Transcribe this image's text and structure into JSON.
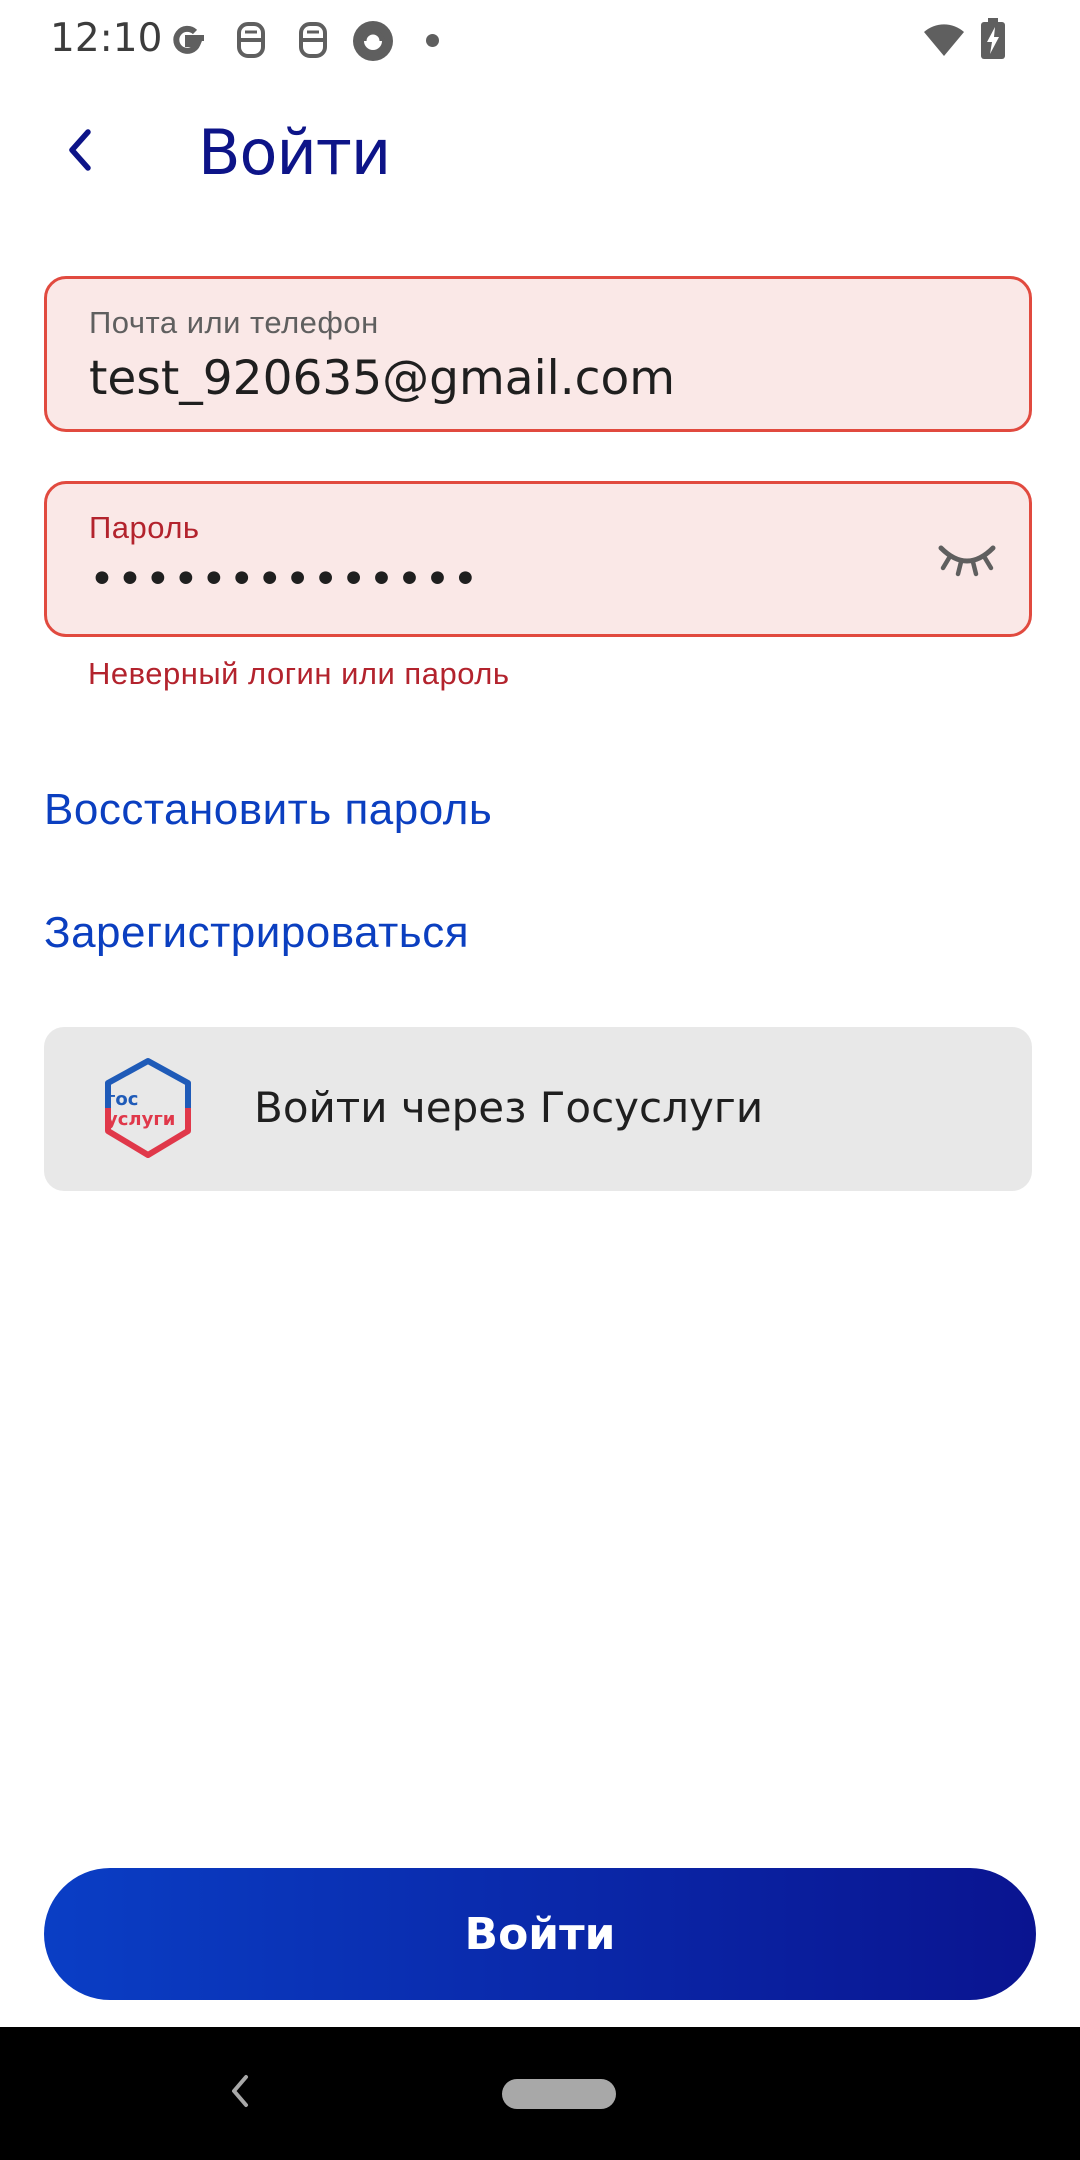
{
  "status_bar": {
    "time": "12:10",
    "icons": [
      "google-icon",
      "app-icon",
      "app-icon",
      "sync-icon",
      "notification-dot",
      "wifi-icon",
      "battery-charging-icon"
    ]
  },
  "header": {
    "back_icon": "chevron-left-icon",
    "title": "Войти"
  },
  "form": {
    "email": {
      "label": "Почта или телефон",
      "value": "test_920635@gmail.com"
    },
    "password": {
      "label": "Пароль",
      "masked_value": "••••••••••••••",
      "toggle_icon": "eye-closed-icon"
    },
    "error": "Неверный логин или пароль"
  },
  "links": {
    "restore": "Восстановить пароль",
    "register": "Зарегистрироваться"
  },
  "gosuslugi": {
    "logo_line1": "гос",
    "logo_line2": "услуги",
    "label": "Войти через Госуслуги"
  },
  "submit": {
    "label": "Войти"
  },
  "colors": {
    "accent": "#0b3fc0",
    "title": "#0d1488",
    "error": "#b3232d",
    "field_bg": "#fae8e7",
    "field_border": "#e14a3f",
    "button_gradient_start": "#0a3ec5",
    "button_gradient_end": "#0a1490"
  }
}
